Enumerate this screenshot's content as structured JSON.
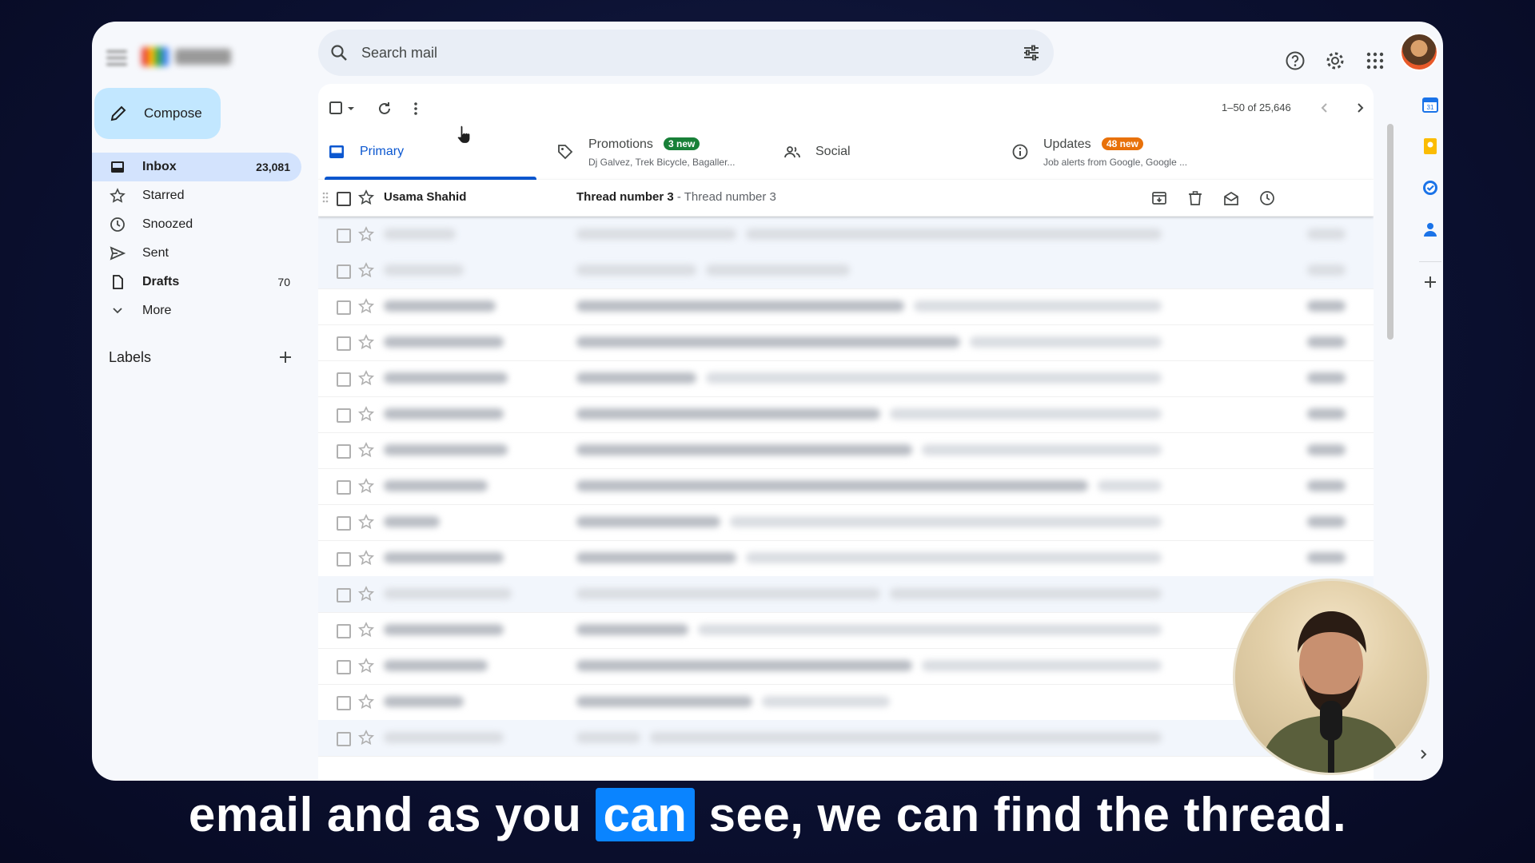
{
  "search": {
    "placeholder": "Search mail"
  },
  "sidebar": {
    "compose_label": "Compose",
    "items": [
      {
        "label": "Inbox",
        "count": "23,081",
        "icon": "inbox-icon"
      },
      {
        "label": "Starred",
        "count": "",
        "icon": "star-icon"
      },
      {
        "label": "Snoozed",
        "count": "",
        "icon": "clock-icon"
      },
      {
        "label": "Sent",
        "count": "",
        "icon": "send-icon"
      },
      {
        "label": "Drafts",
        "count": "70",
        "icon": "draft-icon"
      },
      {
        "label": "More",
        "count": "",
        "icon": "chevron-down-icon"
      }
    ],
    "labels_heading": "Labels"
  },
  "toolbar": {
    "pager": "1–50 of 25,646"
  },
  "tabs": {
    "primary": "Primary",
    "promotions": {
      "label": "Promotions",
      "badge": "3 new",
      "badge_color": "#188038",
      "sub": "Dj Galvez, Trek Bicycle, Bagaller..."
    },
    "social": "Social",
    "updates": {
      "label": "Updates",
      "badge": "48 new",
      "badge_color": "#e8710a",
      "sub": "Job alerts from Google, Google ..."
    }
  },
  "emails": {
    "first": {
      "sender": "Usama Shahid",
      "subject": "Thread number 3",
      "snippet": " - Thread number 3"
    }
  },
  "caption": {
    "before": "email and as you ",
    "highlight": "can",
    "after": " see, we can find the thread."
  },
  "colors": {
    "accent": "#0b57d0",
    "compose_bg": "#c2e7ff",
    "active_nav": "#d3e3fd",
    "caption_highlight": "#0a84ff"
  }
}
